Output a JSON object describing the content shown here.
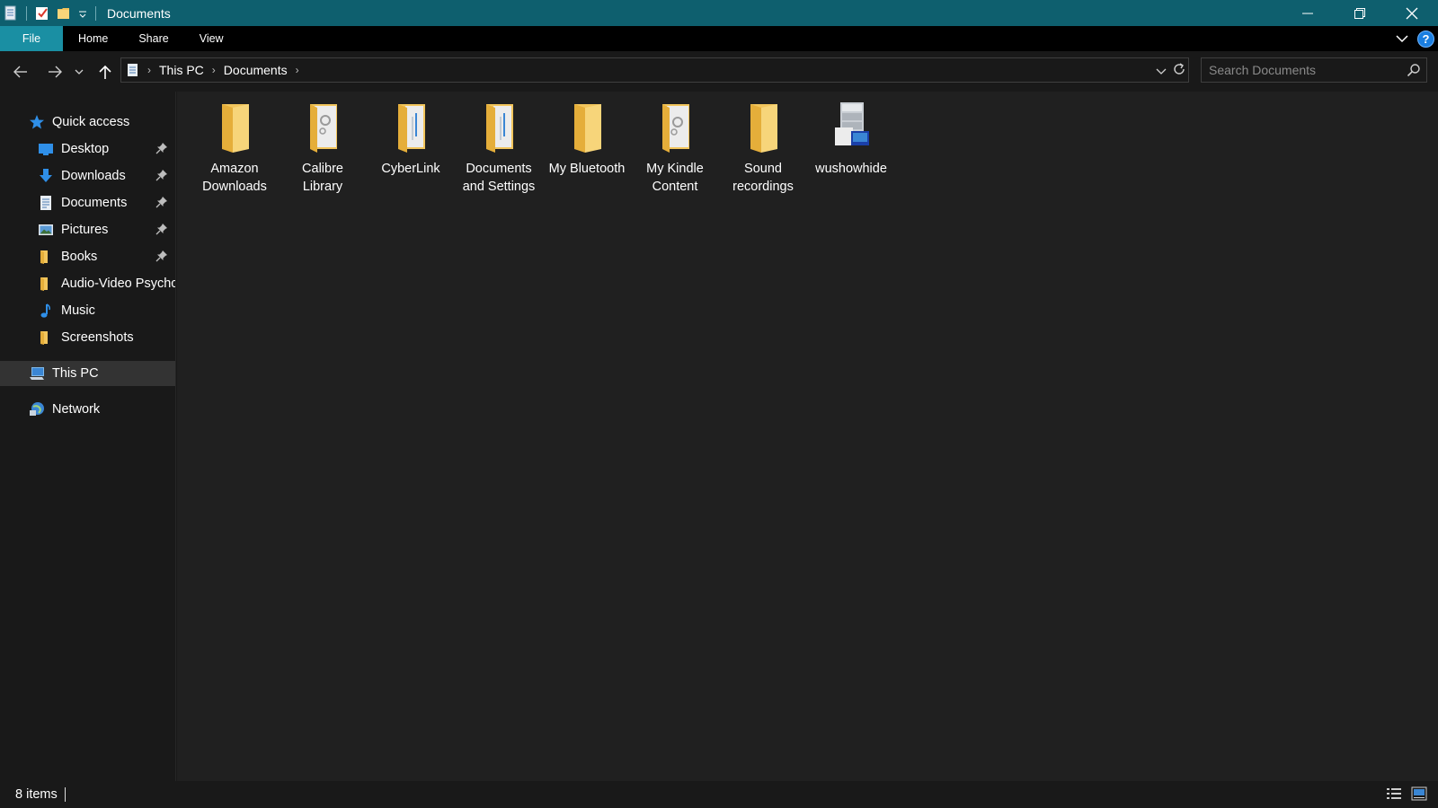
{
  "window": {
    "title": "Documents"
  },
  "ribbon": {
    "tabs": [
      "File",
      "Home",
      "Share",
      "View"
    ]
  },
  "address": {
    "breadcrumbs": [
      "This PC",
      "Documents"
    ],
    "search_placeholder": "Search Documents"
  },
  "sidebar": {
    "quick_access_label": "Quick access",
    "items": [
      {
        "label": "Desktop",
        "icon": "desktop-icon",
        "pinned": true
      },
      {
        "label": "Downloads",
        "icon": "download-arrow-icon",
        "pinned": true
      },
      {
        "label": "Documents",
        "icon": "document-icon",
        "pinned": true
      },
      {
        "label": "Pictures",
        "icon": "pictures-icon",
        "pinned": true
      },
      {
        "label": "Books",
        "icon": "folder-icon",
        "pinned": true
      },
      {
        "label": "Audio-Video Psychc",
        "icon": "folder-icon",
        "pinned": false
      },
      {
        "label": "Music",
        "icon": "music-note-icon",
        "pinned": false
      },
      {
        "label": "Screenshots",
        "icon": "folder-icon",
        "pinned": false
      }
    ],
    "this_pc_label": "This PC",
    "network_label": "Network"
  },
  "files": [
    {
      "name": "Amazon Downloads",
      "icon": "folder-icon"
    },
    {
      "name": "Calibre Library",
      "icon": "folder-with-documents-icon"
    },
    {
      "name": "CyberLink",
      "icon": "folder-with-documents-icon"
    },
    {
      "name": "Documents and Settings",
      "icon": "folder-with-documents-icon"
    },
    {
      "name": "My Bluetooth",
      "icon": "folder-icon"
    },
    {
      "name": "My Kindle Content",
      "icon": "folder-with-documents-icon"
    },
    {
      "name": "Sound recordings",
      "icon": "folder-icon"
    },
    {
      "name": "wushowhide",
      "icon": "troubleshooter-app-icon"
    }
  ],
  "status": {
    "item_count": "8 items"
  },
  "colors": {
    "titlebar": "#0e5f6e",
    "file_tab": "#1a8fa3",
    "folder": "#f2c55c",
    "background": "#202020",
    "accent_blue": "#1a7ee0"
  }
}
